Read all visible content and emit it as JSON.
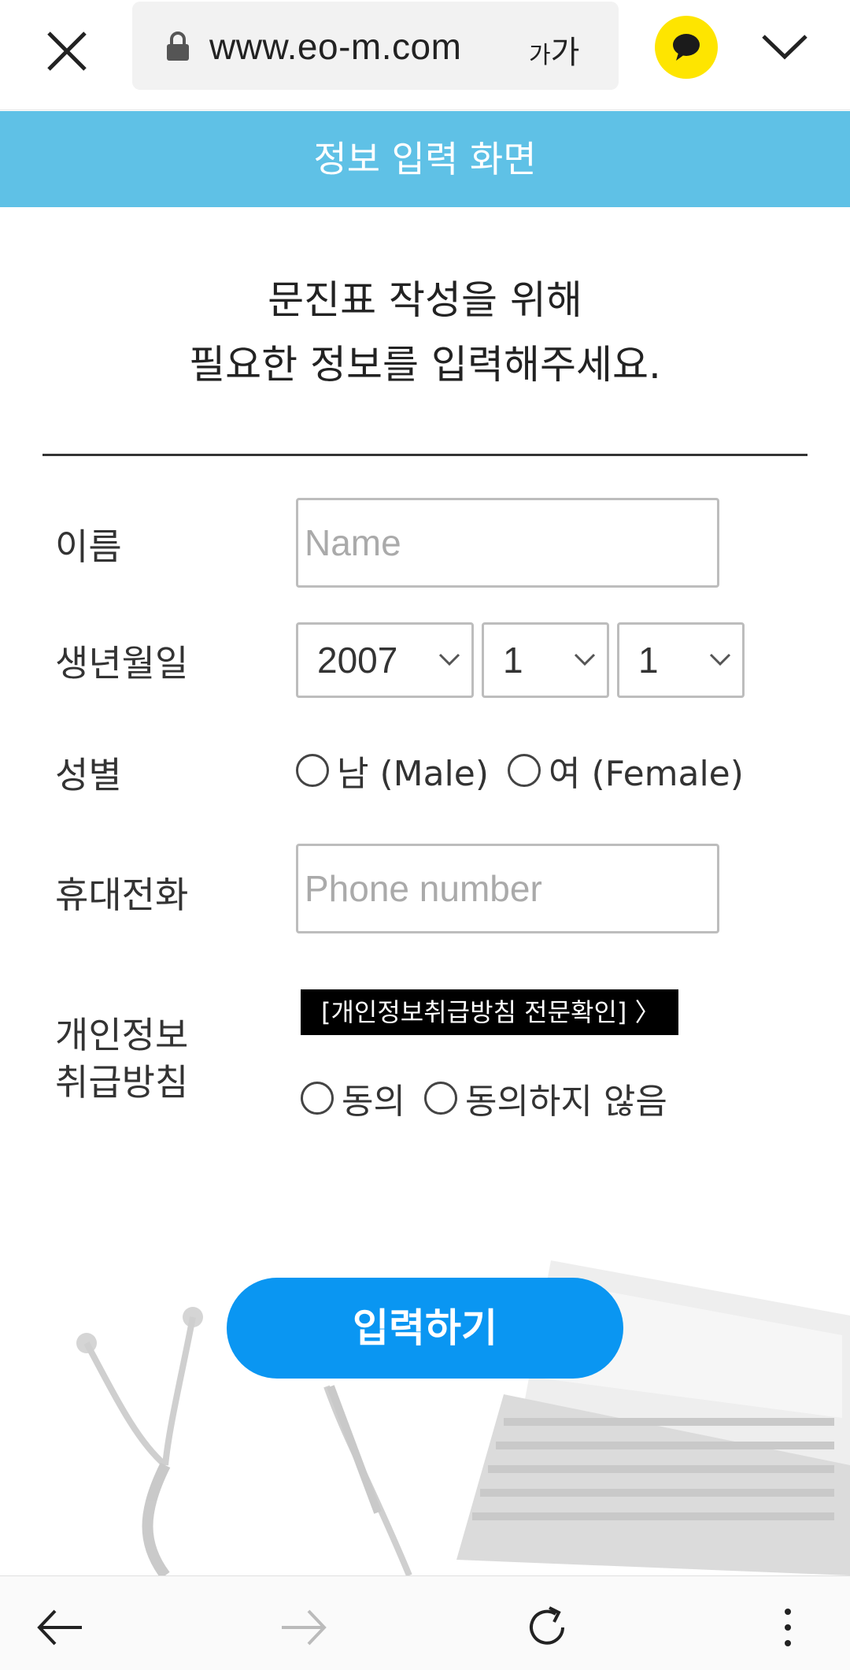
{
  "browser": {
    "url": "www.eo-m.com",
    "text_size_small": "가",
    "text_size_large": "가"
  },
  "banner": {
    "title": "정보 입력 화면"
  },
  "intro": {
    "line1": "문진표 작성을 위해",
    "line2": "필요한 정보를 입력해주세요."
  },
  "form": {
    "name_label": "이름",
    "name_placeholder": "Name",
    "birth_label": "생년월일",
    "birth_year": "2007",
    "birth_month": "1",
    "birth_day": "1",
    "gender_label": "성별",
    "gender_male": "남 (Male)",
    "gender_female": "여 (Female)",
    "phone_label": "휴대전화",
    "phone_placeholder": "Phone number",
    "privacy_label_line1": "개인정보",
    "privacy_label_line2": "취급방침",
    "privacy_link": "[개인정보취급방침 전문확인] 〉",
    "agree": "동의",
    "disagree": "동의하지 않음",
    "submit": "입력하기"
  },
  "colors": {
    "banner": "#5fc1e6",
    "submit": "#0a96f2",
    "kakao_talk": "#fee500"
  },
  "icons": {
    "close": "close-icon",
    "lock": "lock-icon",
    "talk": "kakaotalk-icon",
    "menu_toggle": "chevron-down-icon",
    "back": "back-arrow-icon",
    "forward": "forward-arrow-icon",
    "reload": "reload-icon",
    "more": "more-vertical-icon"
  }
}
